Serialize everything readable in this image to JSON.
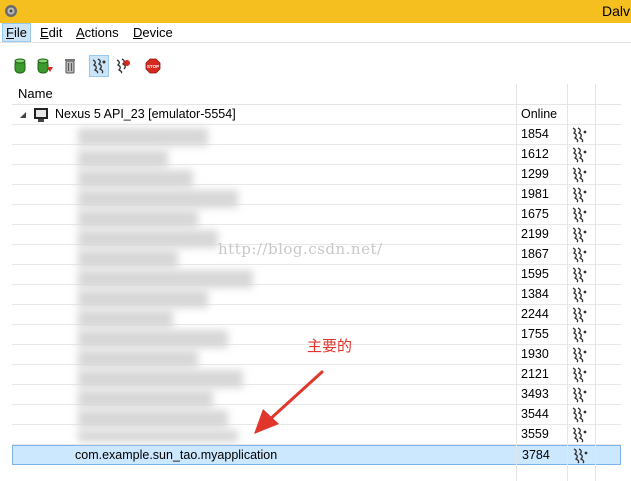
{
  "window": {
    "title": "Dalv"
  },
  "menu": [
    {
      "label": "File",
      "accel": "F",
      "rest": "ile",
      "active": true
    },
    {
      "label": "Edit",
      "accel": "E",
      "rest": "dit",
      "active": false
    },
    {
      "label": "Actions",
      "accel": "A",
      "rest": "ctions",
      "active": false
    },
    {
      "label": "Device",
      "accel": "D",
      "rest": "evice",
      "active": false
    }
  ],
  "toolbar": {
    "buttons": [
      {
        "icon": "update-heap-icon",
        "active": false
      },
      {
        "icon": "dump-hprof-icon",
        "active": false
      },
      {
        "icon": "cause-gc-icon",
        "active": false
      },
      {
        "icon": "update-threads-icon",
        "active": true
      },
      {
        "icon": "start-method-profiling-icon",
        "active": false
      },
      {
        "icon": "stop-process-icon",
        "active": false
      }
    ],
    "stop_label": "STOP"
  },
  "table": {
    "columns": {
      "name": "Name",
      "status": ""
    },
    "device": {
      "name": "Nexus 5 API_23 [emulator-5554]",
      "status": "Online"
    },
    "processes": [
      {
        "name": "",
        "pid": "1854"
      },
      {
        "name": "",
        "pid": "1612"
      },
      {
        "name": "",
        "pid": "1299"
      },
      {
        "name": "",
        "pid": "1981"
      },
      {
        "name": "",
        "pid": "1675"
      },
      {
        "name": "",
        "pid": "2199"
      },
      {
        "name": "",
        "pid": "1867"
      },
      {
        "name": "",
        "pid": "1595"
      },
      {
        "name": "",
        "pid": "1384"
      },
      {
        "name": "",
        "pid": "2244"
      },
      {
        "name": "",
        "pid": "1755"
      },
      {
        "name": "",
        "pid": "1930"
      },
      {
        "name": "",
        "pid": "2121"
      },
      {
        "name": "",
        "pid": "3493"
      },
      {
        "name": "",
        "pid": "3544"
      },
      {
        "name": "",
        "pid": "3559"
      },
      {
        "name": "com.example.sun_tao.myapplication",
        "pid": "3784",
        "selected": true
      }
    ]
  },
  "watermark": "http://blog.csdn.net/",
  "annotation": {
    "text": "主要的",
    "color": "#e0362b"
  },
  "colors": {
    "titlebar": "#f5bf1f",
    "selection": "#cce8ff",
    "selection_border": "#7eb4ea"
  }
}
